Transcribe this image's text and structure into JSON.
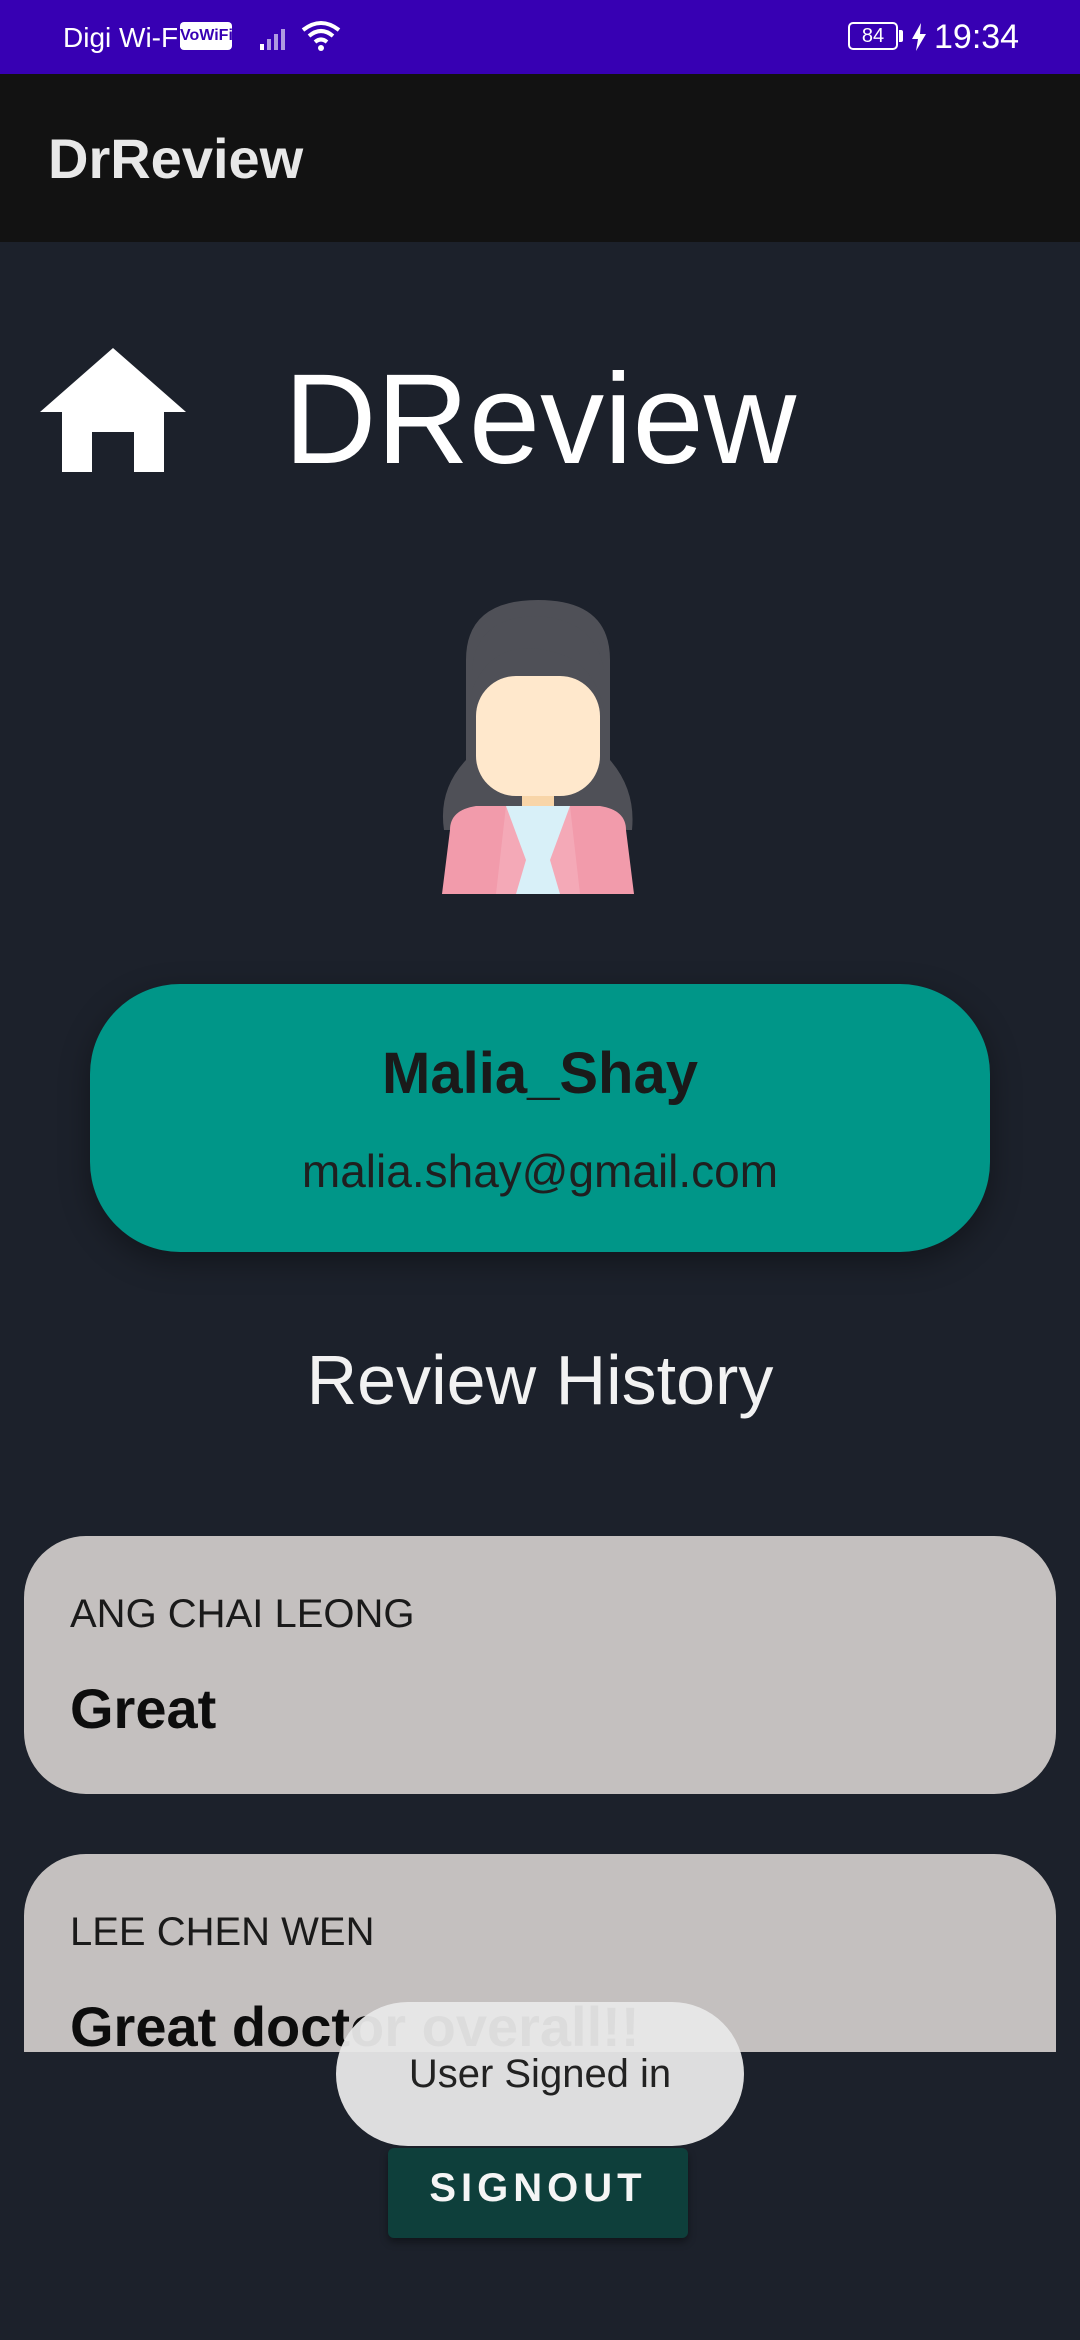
{
  "status_bar": {
    "carrier": "Digi Wi-Fi",
    "vowifi_badge": "VoWiFi",
    "battery": "84",
    "time": "19:34",
    "icons": [
      "signal-icon",
      "wifi-icon",
      "battery-icon",
      "charging-bolt-icon"
    ]
  },
  "app_bar": {
    "title": "DrReview"
  },
  "header": {
    "brand": "DReview",
    "home_icon": "home-icon"
  },
  "profile": {
    "avatar_icon": "female-user-avatar-icon",
    "username": "Malia_Shay",
    "email": "malia.shay@gmail.com"
  },
  "reviews_section": {
    "title": "Review History",
    "items": [
      {
        "doctor": "ANG CHAI LEONG",
        "review": "Great"
      },
      {
        "doctor": "LEE CHEN WEN",
        "review": "Great doctor overall!!"
      }
    ]
  },
  "toast": {
    "message": "User Signed in"
  },
  "actions": {
    "signout_label": "SIGNOUT"
  },
  "colors": {
    "status_bar": "#3700b3",
    "app_bar": "#121212",
    "background": "#1c212b",
    "profile_card": "#009688",
    "review_card": "#c4c0bf",
    "signout_button": "#0e3f3b"
  }
}
